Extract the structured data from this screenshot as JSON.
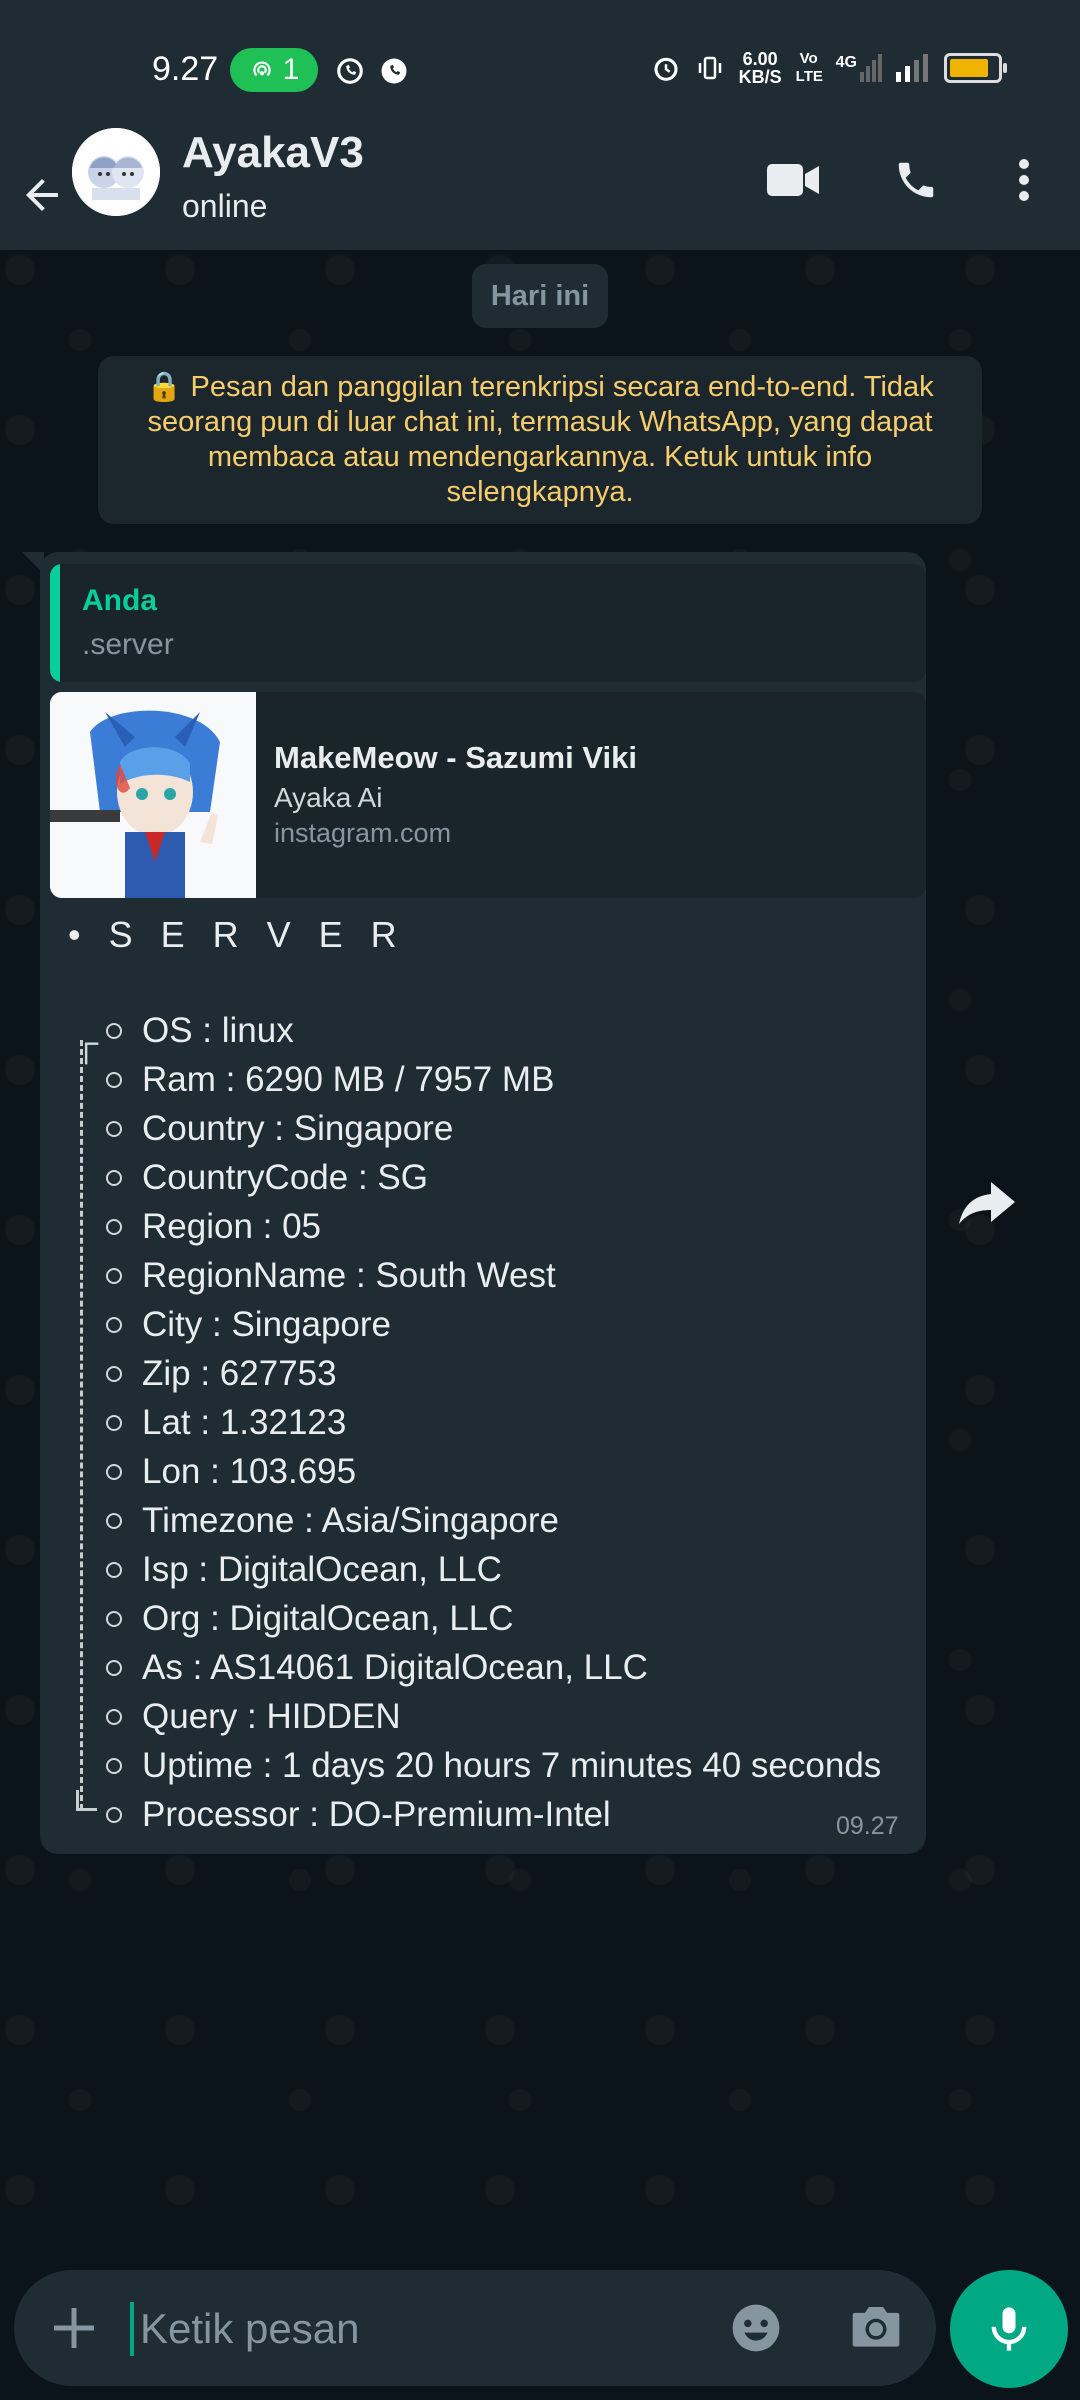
{
  "status_bar": {
    "time": "9.27",
    "hotspot_count": "1",
    "net_speed_value": "6.00",
    "net_speed_unit": "KB/S",
    "volte": "Vo LTE",
    "network": "4G",
    "battery_level": 0.8
  },
  "header": {
    "contact_name": "AyakaV3",
    "contact_status": "online"
  },
  "chat": {
    "date_chip": "Hari ini",
    "encryption_notice": "🔒 Pesan dan panggilan terenkripsi secara end-to-end. Tidak seorang pun di luar chat ini, termasuk WhatsApp, yang dapat membaca atau mendengarkannya. Ketuk untuk info selengkapnya."
  },
  "message": {
    "quote": {
      "author": "Anda",
      "text": ".server"
    },
    "link_preview": {
      "title": "MakeMeow - Sazumi Viki",
      "description": "Ayaka Ai",
      "domain": "instagram.com"
    },
    "heading": "• S E R V E R",
    "tree_top": "┌",
    "items": [
      "OS : linux",
      "Ram : 6290 MB / 7957 MB",
      "Country : Singapore",
      "CountryCode : SG",
      "Region : 05",
      "RegionName : South West",
      "City : Singapore",
      "Zip : 627753",
      "Lat : 1.32123",
      "Lon : 103.695",
      "Timezone : Asia/Singapore",
      "Isp : DigitalOcean, LLC",
      "Org : DigitalOcean, LLC",
      "As : AS14061 DigitalOcean, LLC",
      "Query : HIDDEN",
      "Uptime : 1 days 20 hours 7 minutes 40 seconds",
      "Processor : DO-Premium-Intel"
    ],
    "time": "09.27"
  },
  "input_bar": {
    "placeholder": "Ketik pesan",
    "value": ""
  },
  "colors": {
    "accent": "#00a884",
    "quote_accent": "#06cf9c",
    "notice_text": "#f7cd6c",
    "background": "#0b141a",
    "bubble": "#1f2c34"
  }
}
